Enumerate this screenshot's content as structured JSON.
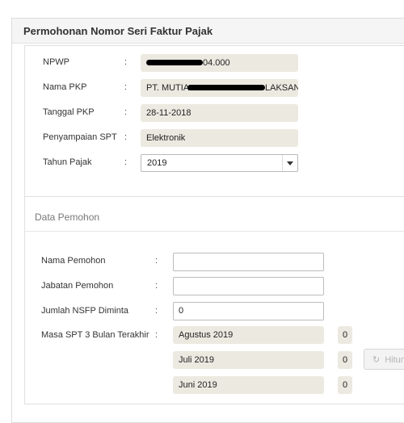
{
  "panel": {
    "title": "Permohonan Nomor Seri Faktur Pajak"
  },
  "taxpayer": {
    "npwp_label": "NPWP",
    "npwp_value": "04.000",
    "nama_pkp_label": "Nama PKP",
    "nama_pkp_prefix": "PT. MUTIA",
    "nama_pkp_suffix": "LAKSANA",
    "tanggal_pkp_label": "Tanggal PKP",
    "tanggal_pkp_value": "28-11-2018",
    "penyampaian_label": "Penyampaian SPT",
    "penyampaian_value": "Elektronik",
    "tahun_pajak_label": "Tahun Pajak",
    "tahun_pajak_value": "2019",
    "colon": ":"
  },
  "applicant": {
    "section_title": "Data Pemohon",
    "nama_pemohon_label": "Nama Pemohon",
    "nama_pemohon_value": "",
    "jabatan_label": "Jabatan Pemohon",
    "jabatan_value": "",
    "jumlah_label": "Jumlah NSFP Diminta",
    "jumlah_value": "0",
    "masa_label": "Masa SPT 3 Bulan Terakhir",
    "masa": [
      {
        "month": "Agustus 2019",
        "count": "0"
      },
      {
        "month": "Juli 2019",
        "count": "0"
      },
      {
        "month": "Juni 2019",
        "count": "0"
      }
    ],
    "hitung_label": "Hitun",
    "hitung_icon": "refresh-icon"
  }
}
